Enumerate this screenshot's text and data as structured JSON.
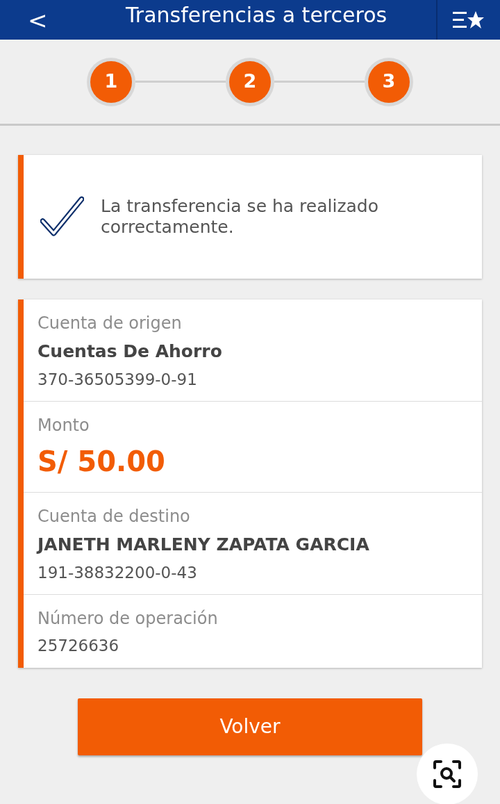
{
  "header": {
    "back": "<",
    "title": "Transferencias a terceros"
  },
  "steps": [
    {
      "label": "1"
    },
    {
      "label": "2"
    },
    {
      "label": "3"
    }
  ],
  "message": {
    "text": "La transferencia se ha realizado correctamente."
  },
  "details": [
    {
      "kind": "account",
      "label": "Cuenta de origen",
      "name": "Cuentas De Ahorro",
      "number": "370-36505399-0-91"
    },
    {
      "kind": "amount",
      "label": "Monto",
      "value": "S/ 50.00"
    },
    {
      "kind": "account",
      "label": "Cuenta de destino",
      "name": "JANETH MARLENY ZAPATA GARCIA",
      "number": "191-38832200-0-43"
    },
    {
      "kind": "plain",
      "label": "Número de operación",
      "value": "25726636"
    }
  ],
  "button": "Volver"
}
